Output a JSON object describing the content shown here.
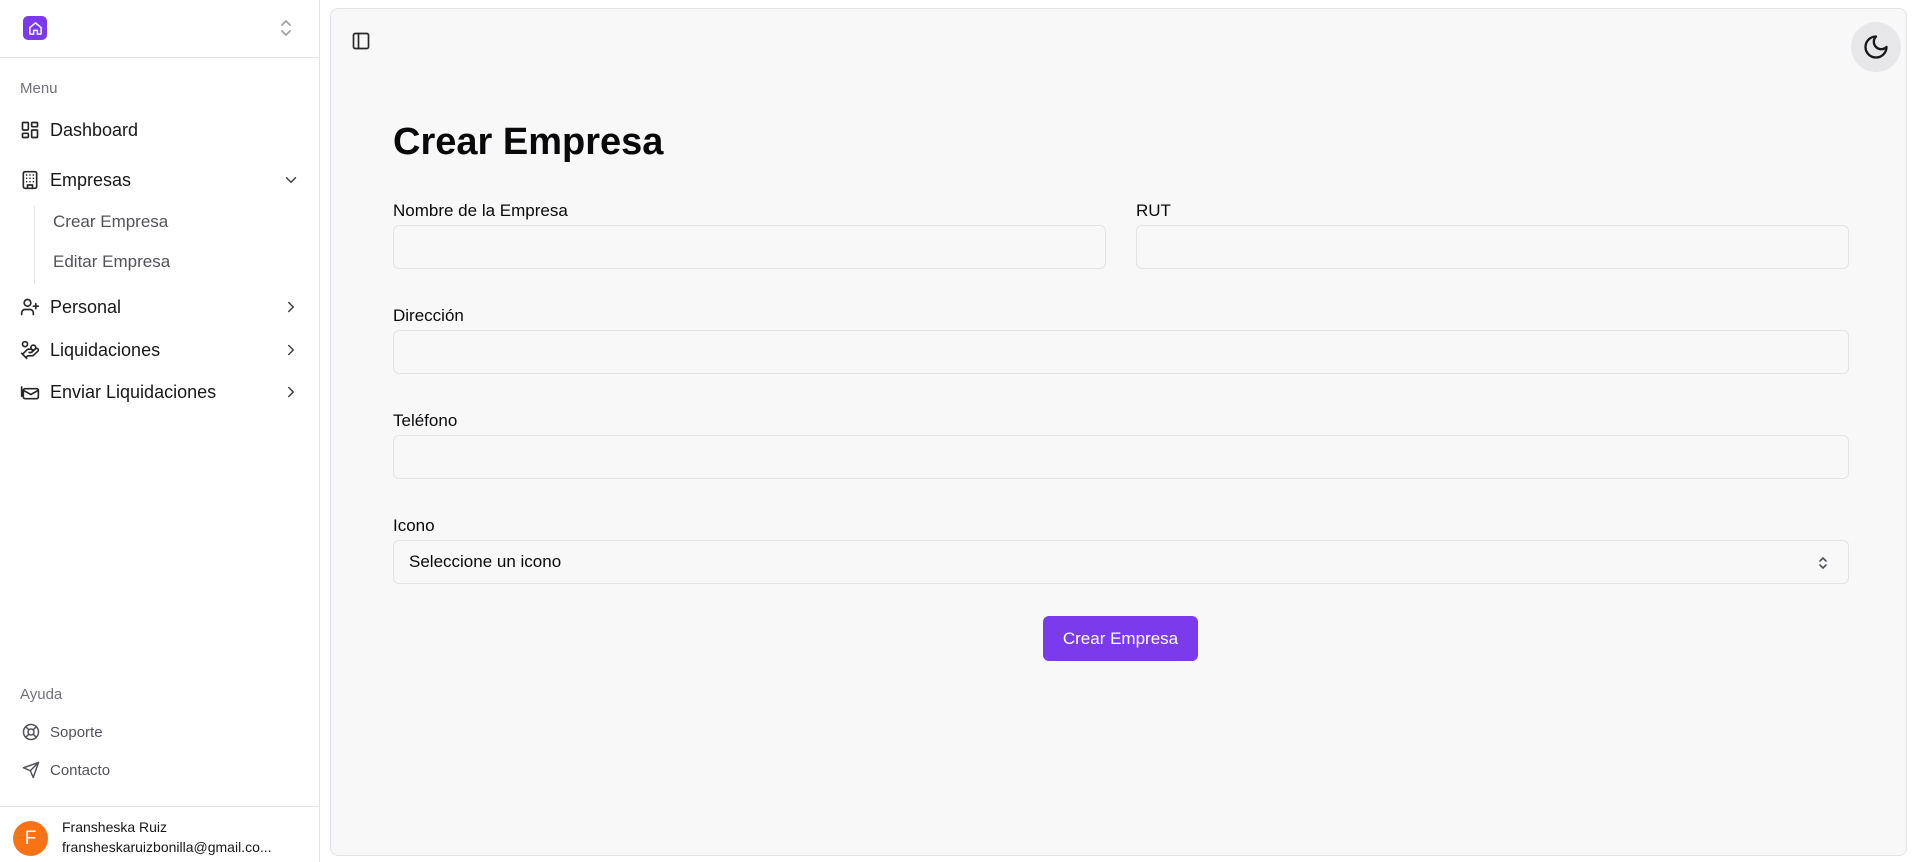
{
  "sidebar": {
    "menu_label": "Menu",
    "items": [
      {
        "label": "Dashboard",
        "icon": "layout-dashboard-icon"
      },
      {
        "label": "Empresas",
        "icon": "building-icon",
        "expanded": true,
        "children": [
          {
            "label": "Crear Empresa"
          },
          {
            "label": "Editar Empresa"
          }
        ]
      },
      {
        "label": "Personal",
        "icon": "user-plus-icon"
      },
      {
        "label": "Liquidaciones",
        "icon": "hand-coins-icon"
      },
      {
        "label": "Enviar Liquidaciones",
        "icon": "send-mail-icon"
      }
    ],
    "help_label": "Ayuda",
    "help_items": [
      {
        "label": "Soporte",
        "icon": "life-buoy-icon"
      },
      {
        "label": "Contacto",
        "icon": "send-icon"
      }
    ],
    "user": {
      "initial": "F",
      "name": "Fransheska Ruiz",
      "email": "fransheskaruizbonilla@gmail.co..."
    }
  },
  "main": {
    "title": "Crear Empresa",
    "form": {
      "nombre": {
        "label": "Nombre de la Empresa",
        "value": "",
        "placeholder": ""
      },
      "rut": {
        "label": "RUT",
        "value": "",
        "placeholder": ""
      },
      "direccion": {
        "label": "Dirección",
        "value": "",
        "placeholder": ""
      },
      "telefono": {
        "label": "Teléfono",
        "value": "",
        "placeholder": ""
      },
      "icono": {
        "label": "Icono",
        "selected": "Seleccione un icono"
      },
      "submit_label": "Crear Empresa"
    }
  },
  "colors": {
    "accent": "#7c3aed",
    "avatar": "#f97316",
    "main_bg": "#f8f8f8",
    "border": "#e4e4e7"
  }
}
